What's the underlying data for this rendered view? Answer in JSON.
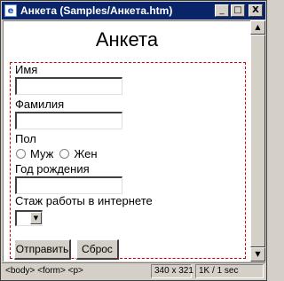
{
  "window": {
    "title": "Анкета (Samples/Анкета.htm)",
    "minimize_glyph": "_",
    "maximize_glyph": "□",
    "close_glyph": "X"
  },
  "page": {
    "title": "Анкета"
  },
  "form": {
    "name_label": "Имя",
    "surname_label": "Фамилия",
    "gender_label": "Пол",
    "gender_options": [
      "Муж",
      "Жен"
    ],
    "birth_year_label": "Год рождения",
    "experience_label": "Стаж работы в интернете",
    "submit_label": "Отправить",
    "reset_label": "Сброс"
  },
  "statusbar": {
    "tag_path": "<body> <form> <p>",
    "dimensions": "340 x 321",
    "size_time": "1K / 1 sec"
  }
}
